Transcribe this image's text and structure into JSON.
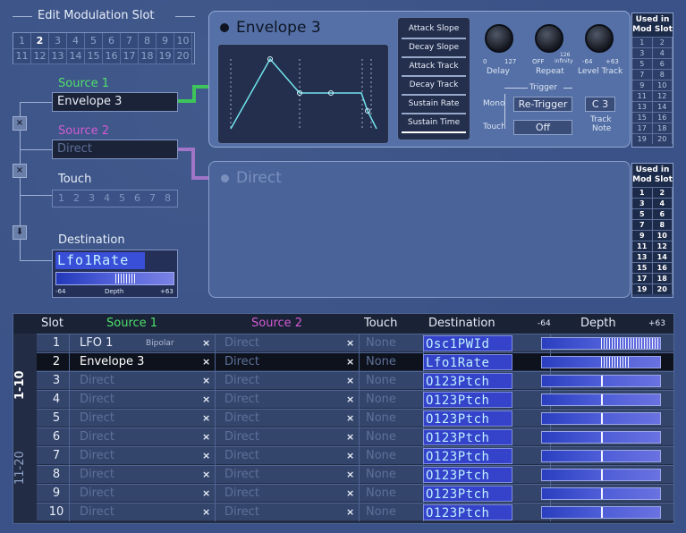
{
  "edit_slot": {
    "title": "Edit Modulation Slot",
    "slots_row1": [
      "1",
      "2",
      "3",
      "4",
      "5",
      "6",
      "7",
      "8",
      "9",
      "10"
    ],
    "slots_row2": [
      "11",
      "12",
      "13",
      "14",
      "15",
      "16",
      "17",
      "18",
      "19",
      "20"
    ],
    "active_slot": "2"
  },
  "source1": {
    "label": "Source 1",
    "value": "Envelope 3",
    "color": "#4ee06a"
  },
  "source2": {
    "label": "Source 2",
    "value": "Direct",
    "color": "#d25bd2"
  },
  "touch": {
    "label": "Touch",
    "digits": [
      "1",
      "2",
      "3",
      "4",
      "5",
      "6",
      "7",
      "8"
    ]
  },
  "destination": {
    "label": "Destination",
    "value": "Lfo1Rate",
    "depth_label": "Depth",
    "depth_min": "-64",
    "depth_max": "+63"
  },
  "envelope_panel": {
    "title": "Envelope 3",
    "buttons": [
      "Attack Slope",
      "Decay Slope",
      "Attack Track",
      "Decay Track",
      "Sustain Rate",
      "Sustain Time"
    ],
    "knobs": [
      {
        "name": "Delay",
        "min": "0",
        "max": "127"
      },
      {
        "name": "Repeat",
        "min": "OFF",
        "max": "126",
        "extra": "infinity"
      },
      {
        "name": "Level Track",
        "min": "-64",
        "max": "+63"
      }
    ],
    "trigger_label": "Trigger",
    "mono_label": "Mono",
    "touch_label": "Touch",
    "retrigger": "Re-Trigger",
    "off": "Off",
    "track_note_value": "C 3",
    "track_note_label1": "Track",
    "track_note_label2": "Note"
  },
  "direct_panel": {
    "title": "Direct"
  },
  "used_in_1": {
    "header1": "Used in",
    "header2": "Mod Slot",
    "rows": [
      [
        "1",
        "2"
      ],
      [
        "3",
        "4"
      ],
      [
        "5",
        "6"
      ],
      [
        "7",
        "8"
      ],
      [
        "9",
        "10"
      ],
      [
        "11",
        "12"
      ],
      [
        "13",
        "14"
      ],
      [
        "15",
        "16"
      ],
      [
        "17",
        "18"
      ],
      [
        "19",
        "20"
      ]
    ]
  },
  "used_in_2": {
    "header1": "Used in",
    "header2": "Mod Slot",
    "rows": [
      [
        "1",
        "2"
      ],
      [
        "3",
        "4"
      ],
      [
        "5",
        "6"
      ],
      [
        "7",
        "8"
      ],
      [
        "9",
        "10"
      ],
      [
        "11",
        "12"
      ],
      [
        "13",
        "14"
      ],
      [
        "15",
        "16"
      ],
      [
        "17",
        "18"
      ],
      [
        "19",
        "20"
      ]
    ]
  },
  "table": {
    "headers": {
      "slot": "Slot",
      "source1": "Source 1",
      "source2": "Source 2",
      "touch": "Touch",
      "destination": "Destination",
      "depth": "Depth",
      "depth_min": "-64",
      "depth_max": "+63"
    },
    "tab_active": "1-10",
    "tab_inactive": "11-20",
    "rows": [
      {
        "slot": "1",
        "source1": "LFO 1",
        "extra": "Bipolar",
        "source2": "Direct",
        "touch": "None",
        "dest": "Osc1PWId",
        "depth": 63,
        "selected": false,
        "dim": false
      },
      {
        "slot": "2",
        "source1": "Envelope 3",
        "extra": "",
        "source2": "Direct",
        "touch": "None",
        "dest": "Lfo1Rate",
        "depth": 30,
        "selected": true,
        "dim": false
      },
      {
        "slot": "3",
        "source1": "Direct",
        "extra": "",
        "source2": "Direct",
        "touch": "None",
        "dest": "O123Ptch",
        "depth": 0,
        "selected": false,
        "dim": true
      },
      {
        "slot": "4",
        "source1": "Direct",
        "extra": "",
        "source2": "Direct",
        "touch": "None",
        "dest": "O123Ptch",
        "depth": 0,
        "selected": false,
        "dim": true
      },
      {
        "slot": "5",
        "source1": "Direct",
        "extra": "",
        "source2": "Direct",
        "touch": "None",
        "dest": "O123Ptch",
        "depth": 0,
        "selected": false,
        "dim": true
      },
      {
        "slot": "6",
        "source1": "Direct",
        "extra": "",
        "source2": "Direct",
        "touch": "None",
        "dest": "O123Ptch",
        "depth": 0,
        "selected": false,
        "dim": true
      },
      {
        "slot": "7",
        "source1": "Direct",
        "extra": "",
        "source2": "Direct",
        "touch": "None",
        "dest": "O123Ptch",
        "depth": 0,
        "selected": false,
        "dim": true
      },
      {
        "slot": "8",
        "source1": "Direct",
        "extra": "",
        "source2": "Direct",
        "touch": "None",
        "dest": "O123Ptch",
        "depth": 0,
        "selected": false,
        "dim": true
      },
      {
        "slot": "9",
        "source1": "Direct",
        "extra": "",
        "source2": "Direct",
        "touch": "None",
        "dest": "O123Ptch",
        "depth": 0,
        "selected": false,
        "dim": true
      },
      {
        "slot": "10",
        "source1": "Direct",
        "extra": "",
        "source2": "Direct",
        "touch": "None",
        "dest": "O123Ptch",
        "depth": 0,
        "selected": false,
        "dim": true
      }
    ]
  }
}
